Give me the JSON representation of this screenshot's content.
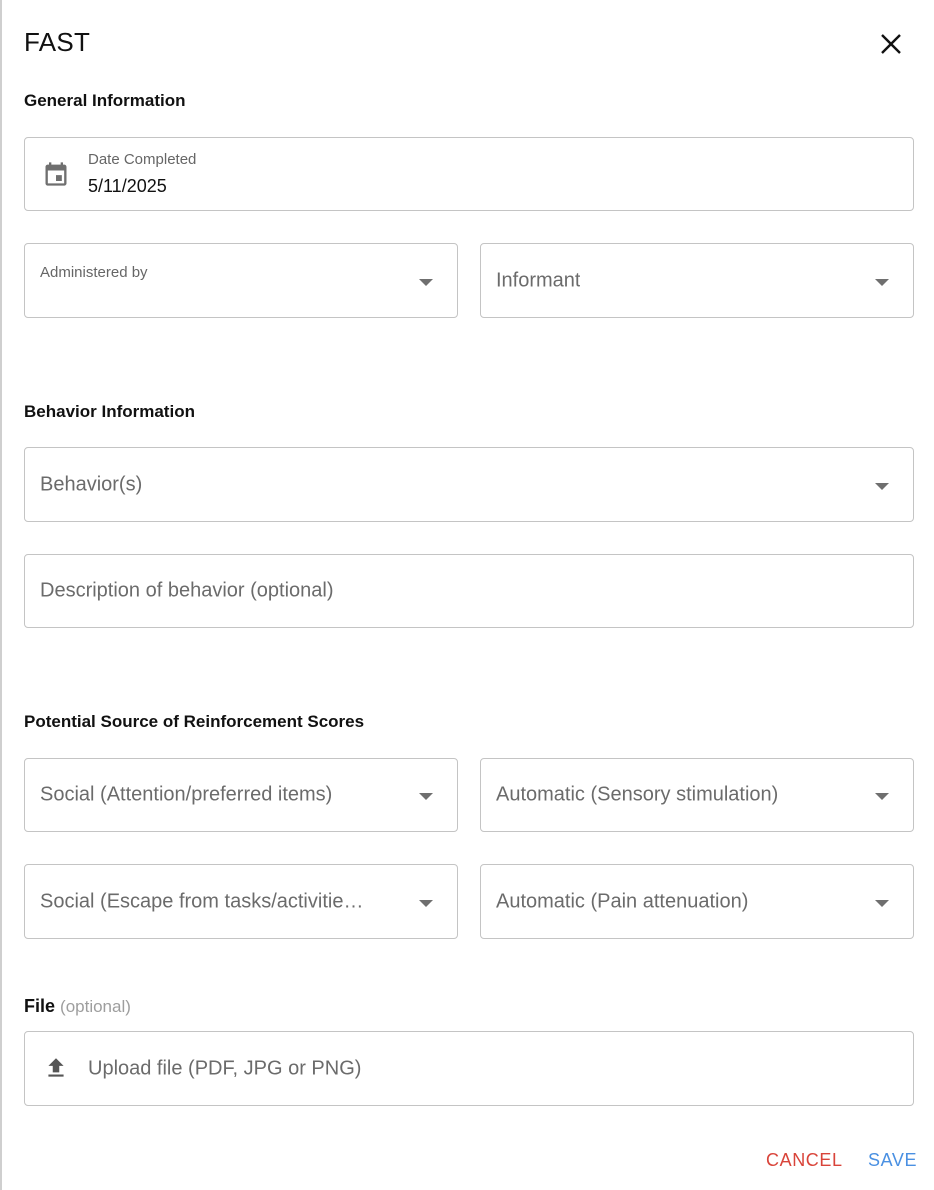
{
  "dialog": {
    "title": "FAST"
  },
  "general": {
    "heading": "General Information",
    "date_label": "Date Completed",
    "date_value": "5/11/2025",
    "administered_label": "Administered by",
    "informant_placeholder": "Informant"
  },
  "behavior": {
    "heading": "Behavior Information",
    "behaviors_placeholder": "Behavior(s)",
    "description_placeholder": "Description of behavior (optional)"
  },
  "reinforcement": {
    "heading": "Potential Source of Reinforcement Scores",
    "social_attention": "Social (Attention/preferred items)",
    "automatic_sensory": "Automatic (Sensory stimulation)",
    "social_escape": "Social (Escape from tasks/activitie…",
    "automatic_pain": "Automatic (Pain attenuation)"
  },
  "file": {
    "label": "File",
    "optional": "(optional)",
    "upload_text": "Upload file (PDF, JPG or PNG)"
  },
  "actions": {
    "cancel": "CANCEL",
    "save": "SAVE"
  },
  "colors": {
    "cancel": "#d9443a",
    "save": "#4a90e2",
    "border": "#c4c4c4"
  },
  "icons": [
    "close-icon",
    "calendar-icon",
    "dropdown-arrow-icon",
    "upload-icon"
  ]
}
